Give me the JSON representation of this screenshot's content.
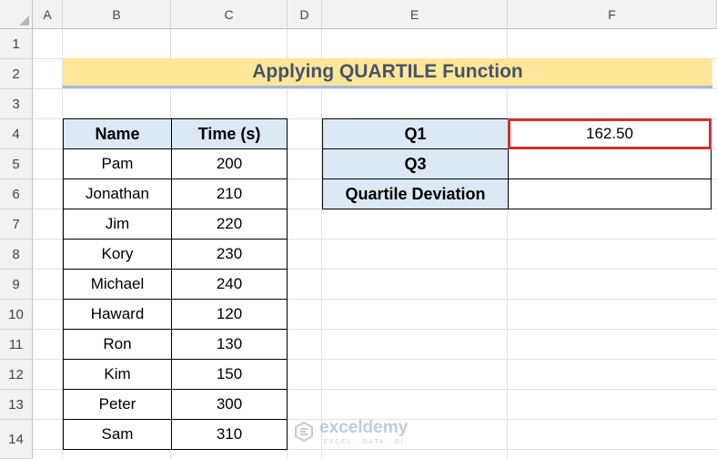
{
  "columns": [
    "A",
    "B",
    "C",
    "D",
    "E",
    "F"
  ],
  "rows": [
    "1",
    "2",
    "3",
    "4",
    "5",
    "6",
    "7",
    "8",
    "9",
    "10",
    "11",
    "12",
    "13",
    "14"
  ],
  "title": "Applying QUARTILE Function",
  "data_table": {
    "headers": [
      "Name",
      "Time (s)"
    ],
    "rows": [
      {
        "name": "Pam",
        "time": "200"
      },
      {
        "name": "Jonathan",
        "time": "210"
      },
      {
        "name": "Jim",
        "time": "220"
      },
      {
        "name": "Kory",
        "time": "230"
      },
      {
        "name": "Michael",
        "time": "240"
      },
      {
        "name": "Haward",
        "time": "120"
      },
      {
        "name": "Ron",
        "time": "130"
      },
      {
        "name": "Kim",
        "time": "150"
      },
      {
        "name": "Peter",
        "time": "300"
      },
      {
        "name": "Sam",
        "time": "310"
      }
    ]
  },
  "result_table": {
    "rows": [
      {
        "label": "Q1",
        "value": "162.50"
      },
      {
        "label": "Q3",
        "value": ""
      },
      {
        "label": "Quartile Deviation",
        "value": ""
      }
    ]
  },
  "watermark": {
    "name": "exceldemy",
    "sub": "EXCEL · DATA · BI"
  },
  "colors": {
    "title_bg": "#ffe699",
    "header_bg": "#dde8f5",
    "selection": "#d32f2f"
  }
}
